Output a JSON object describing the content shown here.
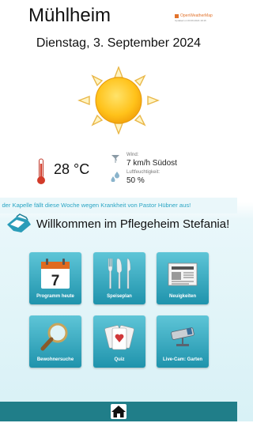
{
  "header": {
    "city": "Mühlheim",
    "provider": "OpenWeatherMap",
    "updated": "Updated on 03.09.2024 19:16",
    "date": "Dienstag, 3. September 2024"
  },
  "weather": {
    "condition_icon": "sun-icon",
    "temperature": "28 °C",
    "wind_label": "Wind:",
    "wind_value": "7 km/h Südost",
    "humidity_label": "Luftfeuchtigkeit:",
    "humidity_value": "50 %"
  },
  "ticker": {
    "text": "In der Kapelle fällt diese Woche wegen Krankheit von Pastor Hübner aus!"
  },
  "welcome": {
    "text": "Willkommen im Pflegeheim Stefania!"
  },
  "tiles": [
    {
      "label": "Programm heute",
      "icon": "calendar-icon",
      "day": "7"
    },
    {
      "label": "Speiseplan",
      "icon": "cutlery-icon"
    },
    {
      "label": "Neuigkeiten",
      "icon": "newspaper-icon"
    },
    {
      "label": "Bewohnersuche",
      "icon": "magnifier-icon"
    },
    {
      "label": "Quiz",
      "icon": "playing-cards-icon"
    },
    {
      "label": "Live-Cam: Garten",
      "icon": "camera-icon"
    }
  ],
  "footer": {
    "home_icon": "home-icon"
  },
  "colors": {
    "accent": "#2aa5c4",
    "tile_top": "#5ec5d7",
    "tile_bottom": "#1f93ac",
    "footer": "#207e89",
    "provider": "#e2732c"
  }
}
